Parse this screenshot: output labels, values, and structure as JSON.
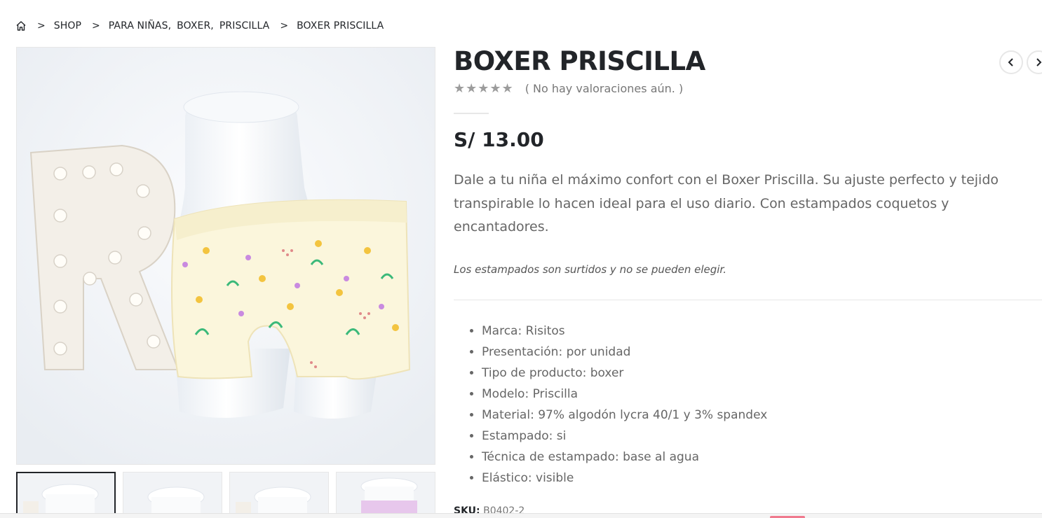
{
  "breadcrumb": {
    "home_icon": "home-icon",
    "shop": "SHOP",
    "categories": [
      "PARA NIÑAS,",
      "BOXER,",
      "PRISCILLA"
    ],
    "current": "BOXER PRISCILLA",
    "separator": ">"
  },
  "product": {
    "title": "BOXER PRISCILLA",
    "stars": "★★★★★",
    "reviews": "( No hay valoraciones aún. )",
    "price": "S/ 13.00",
    "description": "Dale a tu niña el máximo confort con el Boxer Priscilla. Su ajuste perfecto y tejido transpirable lo hacen ideal para el uso diario. Con estampados coquetos y encantadores.",
    "note": "Los estampados son surtidos y no se pueden elegir.",
    "specs": [
      "Marca: Risitos",
      "Presentación: por unidad",
      "Tipo de producto: boxer",
      "Modelo: Priscilla",
      "Material: 97% algodón lycra 40/1 y 3% spandex",
      "Estampado: si",
      "Técnica de estampado: base al agua",
      "Elástico: visible"
    ],
    "sku_label": "SKU:",
    "sku_value": "B0402-2"
  },
  "nav": {
    "prev": "‹",
    "next": "›"
  },
  "colors": {
    "text": "#222529",
    "muted": "#666666",
    "star": "#9c9c9c",
    "pill": "#f07a8e"
  }
}
